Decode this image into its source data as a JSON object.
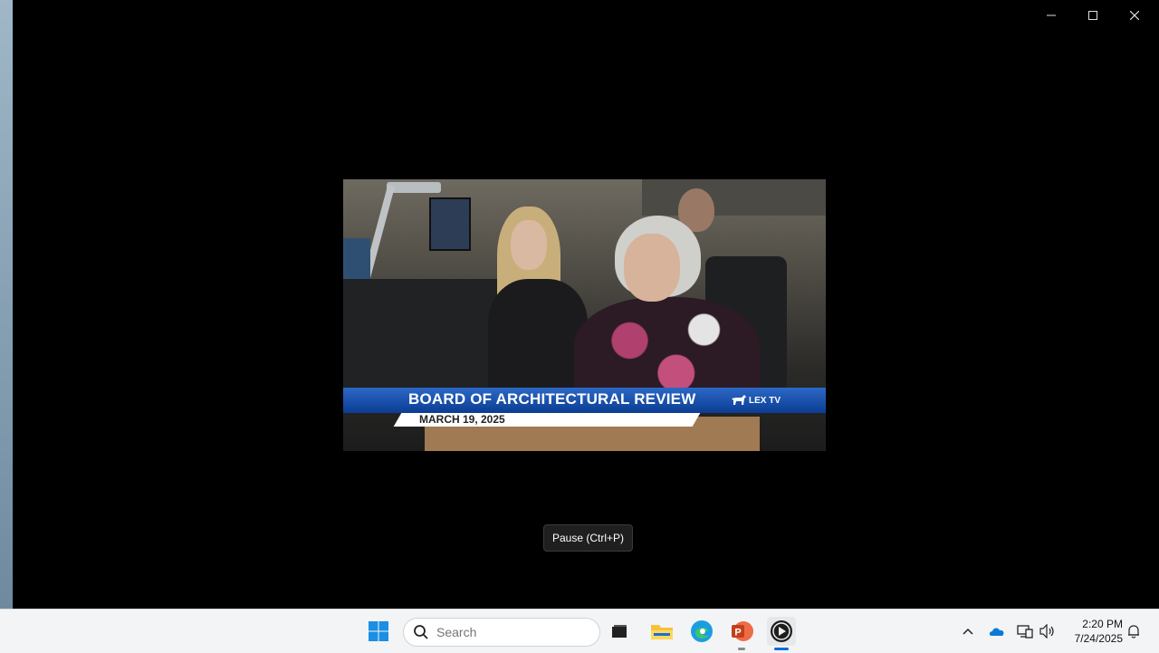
{
  "video": {
    "banner_title": "BOARD OF ARCHITECTURAL REVIEW",
    "banner_date": "MARCH 19, 2025",
    "channel_logo": "LEX TV"
  },
  "tooltip": "Pause (Ctrl+P)",
  "window_controls": {
    "minimize_icon": "minimize-icon",
    "maximize_icon": "maximize-icon",
    "close_icon": "close-icon"
  },
  "taskbar": {
    "search_placeholder": "Search",
    "apps": [
      "start-icon",
      "file-explorer-icon",
      "edge-icon",
      "powerpoint-icon",
      "media-player-icon"
    ],
    "tray": [
      "chevron-up-icon",
      "onedrive-icon",
      "network-icon",
      "volume-icon",
      "notification-icon"
    ],
    "time": "2:20 PM",
    "date": "7/24/2025"
  },
  "colors": {
    "banner_blue": "#0b3d93",
    "taskbar_bg": "#f3f4f6",
    "accent": "#0a6cd6"
  }
}
